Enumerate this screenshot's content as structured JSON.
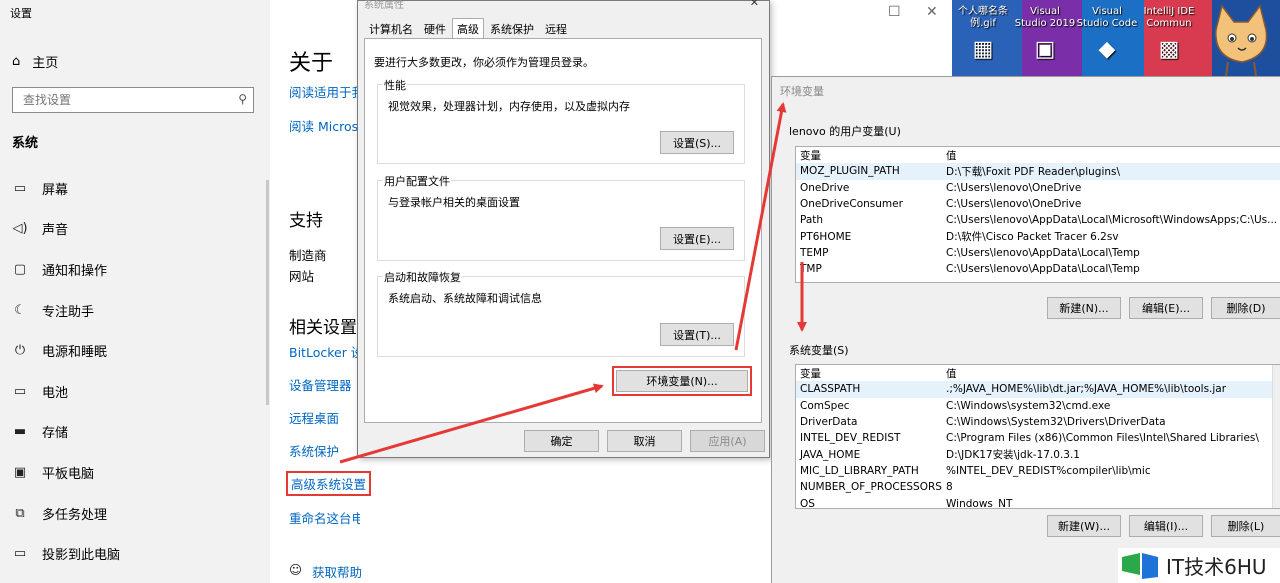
{
  "settings": {
    "title": "设置",
    "home": "主页",
    "search_placeholder": "查找设置",
    "section": "系统",
    "nav_items": [
      {
        "label": "屏幕",
        "icon": "monitor-icon"
      },
      {
        "label": "声音",
        "icon": "speaker-icon"
      },
      {
        "label": "通知和操作",
        "icon": "notification-icon"
      },
      {
        "label": "专注助手",
        "icon": "moon-icon"
      },
      {
        "label": "电源和睡眠",
        "icon": "power-icon"
      },
      {
        "label": "电池",
        "icon": "battery-icon"
      },
      {
        "label": "存储",
        "icon": "storage-icon"
      },
      {
        "label": "平板电脑",
        "icon": "tablet-icon"
      },
      {
        "label": "多任务处理",
        "icon": "multitask-icon"
      },
      {
        "label": "投影到此电脑",
        "icon": "project-icon"
      }
    ],
    "main": {
      "about": "关于",
      "link1": "阅读适用于我",
      "link2": "阅读 Microso",
      "support": "支持",
      "manufacturer": "制造商",
      "website": "网站",
      "related": "相关设置",
      "bitlocker": "BitLocker 设",
      "device_manager": "设备管理器",
      "remote_desktop": "远程桌面",
      "system_protection": "系统保护",
      "advanced": "高级系统设置",
      "rename": "重命名这台电脑",
      "help": "获取帮助"
    }
  },
  "sysprops": {
    "title": "系统属性",
    "tabs": [
      "计算机名",
      "硬件",
      "高级",
      "系统保护",
      "远程"
    ],
    "active_tab": "高级",
    "admin_note": "要进行大多数更改，你必须作为管理员登录。",
    "groups": [
      {
        "title": "性能",
        "desc": "视觉效果，处理器计划，内存使用，以及虚拟内存",
        "button": "设置(S)..."
      },
      {
        "title": "用户配置文件",
        "desc": "与登录帐户相关的桌面设置",
        "button": "设置(E)..."
      },
      {
        "title": "启动和故障恢复",
        "desc": "系统启动、系统故障和调试信息",
        "button": "设置(T)..."
      }
    ],
    "env_button": "环境变量(N)...",
    "ok": "确定",
    "cancel": "取消",
    "apply": "应用(A)"
  },
  "desktop": {
    "icons": [
      {
        "label": "个人哪名条\n例.gif",
        "icon": "gif-file-icon"
      },
      {
        "label": "Visual\nStudio 2019",
        "icon": "visual-studio-icon"
      },
      {
        "label": "Visual\nStudio Code",
        "icon": "vscode-icon"
      },
      {
        "label": "IntelliJ IDE\nCommun",
        "icon": "intellij-icon"
      }
    ]
  },
  "envvars": {
    "title": "环境变量",
    "user_section": "lenovo 的用户变量(U)",
    "columns": [
      "变量",
      "值"
    ],
    "user_vars": [
      [
        "MOZ_PLUGIN_PATH",
        "D:\\下载\\Foxit PDF Reader\\plugins\\"
      ],
      [
        "OneDrive",
        "C:\\Users\\lenovo\\OneDrive"
      ],
      [
        "OneDriveConsumer",
        "C:\\Users\\lenovo\\OneDrive"
      ],
      [
        "Path",
        "C:\\Users\\lenovo\\AppData\\Local\\Microsoft\\WindowsApps;C:\\Us..."
      ],
      [
        "PT6HOME",
        "D:\\软件\\Cisco Packet Tracer 6.2sv"
      ],
      [
        "TEMP",
        "C:\\Users\\lenovo\\AppData\\Local\\Temp"
      ],
      [
        "TMP",
        "C:\\Users\\lenovo\\AppData\\Local\\Temp"
      ]
    ],
    "user_buttons": [
      "新建(N)...",
      "编辑(E)...",
      "删除(D)"
    ],
    "system_section": "系统变量(S)",
    "system_vars": [
      [
        "CLASSPATH",
        ".;%JAVA_HOME%\\lib\\dt.jar;%JAVA_HOME%\\lib\\tools.jar"
      ],
      [
        "ComSpec",
        "C:\\Windows\\system32\\cmd.exe"
      ],
      [
        "DriverData",
        "C:\\Windows\\System32\\Drivers\\DriverData"
      ],
      [
        "INTEL_DEV_REDIST",
        "C:\\Program Files (x86)\\Common Files\\Intel\\Shared Libraries\\"
      ],
      [
        "JAVA_HOME",
        "D:\\JDK17安装\\jdk-17.0.3.1"
      ],
      [
        "MIC_LD_LIBRARY_PATH",
        "%INTEL_DEV_REDIST%compiler\\lib\\mic"
      ],
      [
        "NUMBER_OF_PROCESSORS",
        "8"
      ],
      [
        "OS",
        "Windows_NT"
      ]
    ],
    "system_buttons": [
      "新建(W)...",
      "编辑(I)...",
      "删除(L)"
    ]
  },
  "watermark": "IT技术6HU",
  "colors": {
    "accent_link": "#0067c0",
    "highlight_red": "#e53935",
    "desktop_blue": "#1e4f9f"
  }
}
